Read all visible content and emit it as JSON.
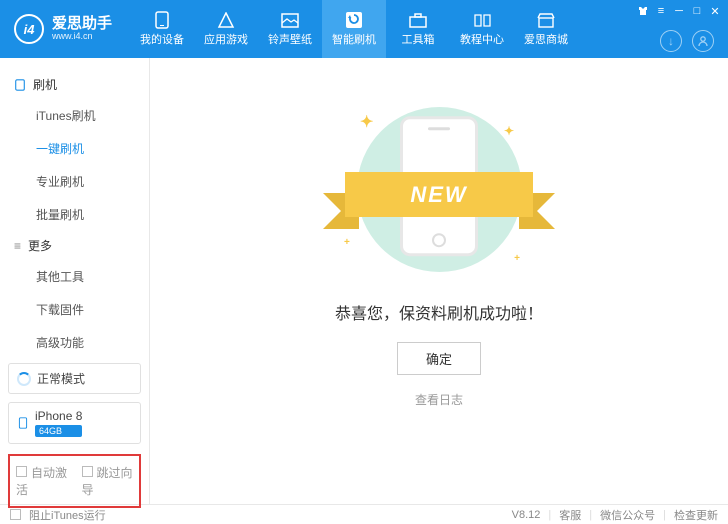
{
  "brand": {
    "name": "爱思助手",
    "url": "www.i4.cn",
    "logo_text": "i4"
  },
  "topnav": [
    {
      "label": "我的设备"
    },
    {
      "label": "应用游戏"
    },
    {
      "label": "铃声壁纸"
    },
    {
      "label": "智能刷机"
    },
    {
      "label": "工具箱"
    },
    {
      "label": "教程中心"
    },
    {
      "label": "爱思商城"
    }
  ],
  "sidebar": {
    "section1_title": "刷机",
    "section1_items": [
      "iTunes刷机",
      "一键刷机",
      "专业刷机",
      "批量刷机"
    ],
    "section2_title": "更多",
    "section2_items": [
      "其他工具",
      "下载固件",
      "高级功能"
    ],
    "mode_label": "正常模式",
    "device_name": "iPhone 8",
    "device_badge": "64GB",
    "auto_activate": "自动激活",
    "skip_wizard": "跳过向导"
  },
  "main": {
    "ribbon_text": "NEW",
    "success_text": "恭喜您，保资料刷机成功啦！",
    "ok_label": "确定",
    "log_link": "查看日志"
  },
  "footer": {
    "block_itunes": "阻止iTunes运行",
    "version": "V8.12",
    "support": "客服",
    "wechat": "微信公众号",
    "update": "检查更新"
  }
}
